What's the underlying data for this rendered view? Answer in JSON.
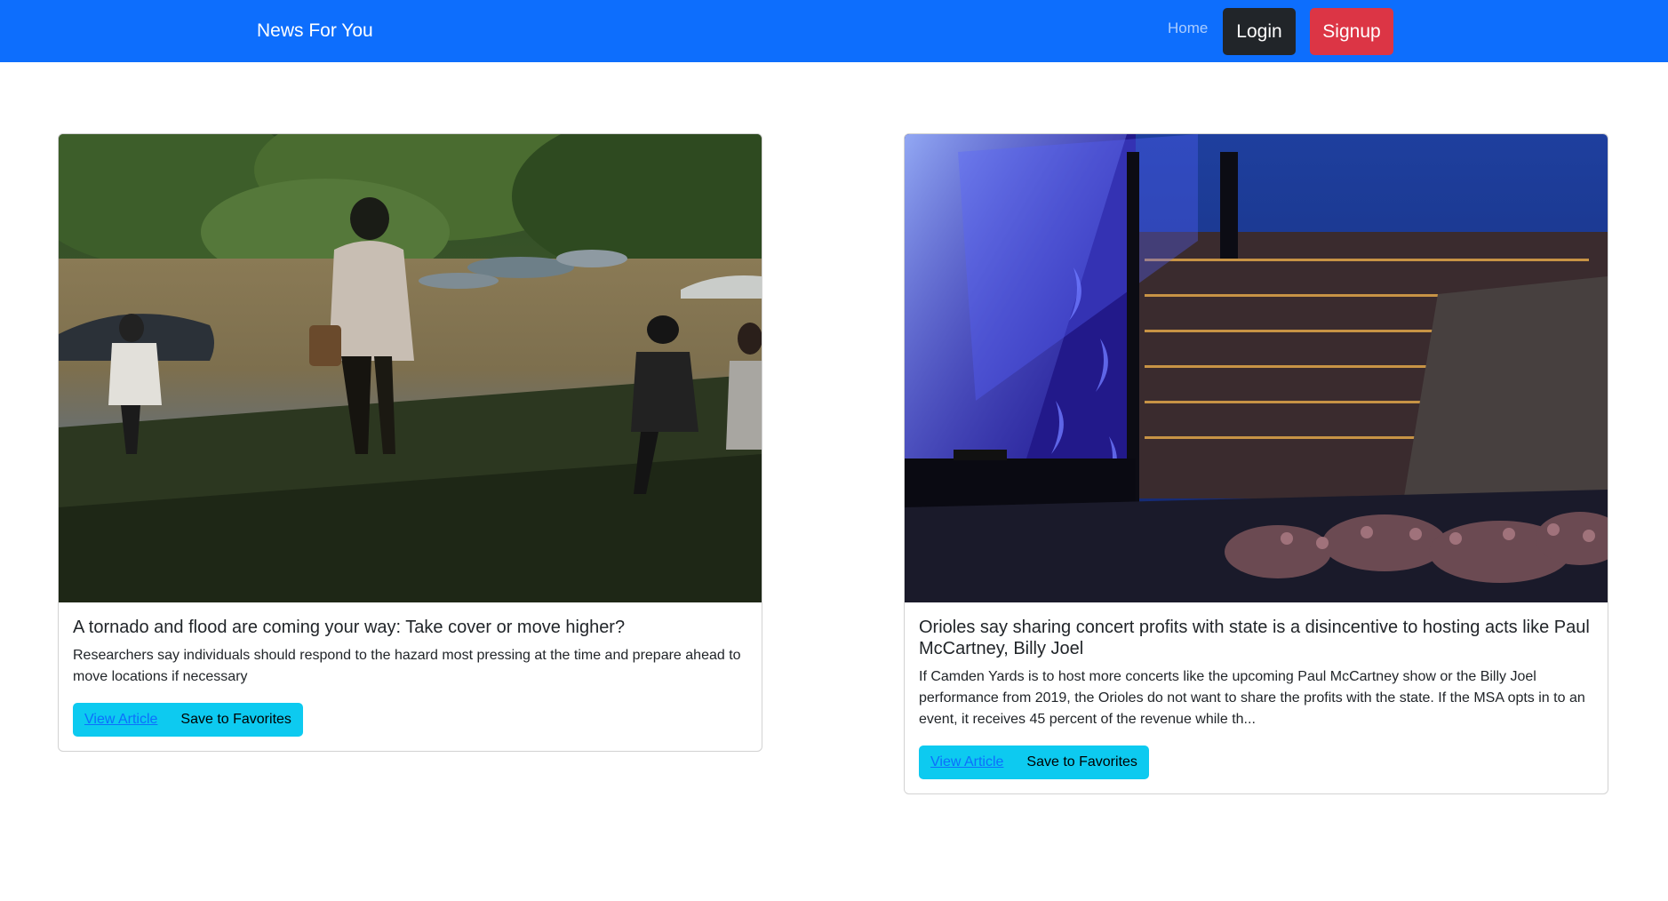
{
  "navbar": {
    "brand": "News For You",
    "home_link": "Home",
    "login_label": "Login",
    "signup_label": "Signup"
  },
  "articles": [
    {
      "title": "A tornado and flood are coming your way: Take cover or move higher?",
      "description": "Researchers say individuals should respond to the hazard most pressing at the time and prepare ahead to move locations if necessary",
      "view_label": "View Article",
      "favorite_label": "Save to Favorites"
    },
    {
      "title": "Orioles say sharing concert profits with state is a disincentive to hosting acts like Paul McCartney, Billy Joel",
      "description": "If Camden Yards is to host more concerts like the upcoming Paul McCartney show or the Billy Joel performance from 2019, the Orioles do not want to share the profits with the state. If the MSA opts in to an event, it receives 45 percent of the revenue while th...",
      "view_label": "View Article",
      "favorite_label": "Save to Favorites"
    }
  ],
  "colors": {
    "navbar_bg": "#0d6efd",
    "login_bg": "#212529",
    "signup_bg": "#dc3545",
    "button_info": "#0dcaf0"
  }
}
